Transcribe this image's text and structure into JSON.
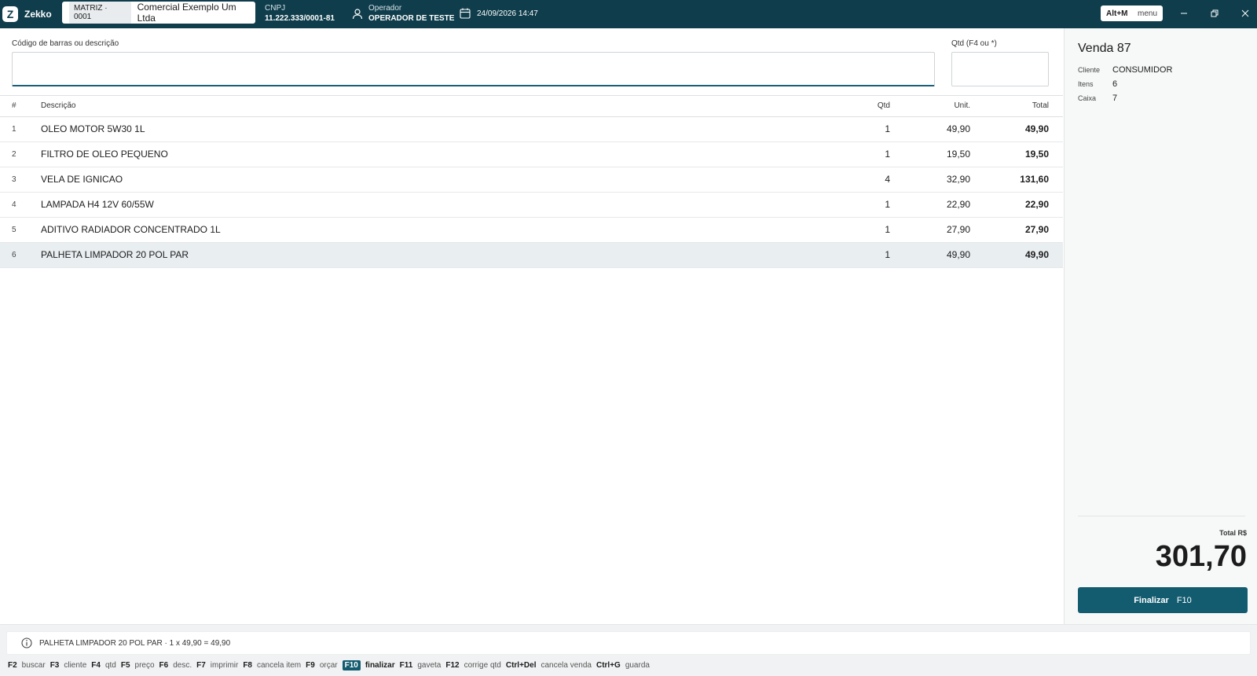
{
  "app": {
    "name": "Zekko",
    "logo_letter": "Z"
  },
  "header": {
    "company_code": "MATRIZ · 0001",
    "company_name": "Comercial Exemplo Um Ltda",
    "cnpj_label": "CNPJ",
    "cnpj_value": "11.222.333/0001-81",
    "operator_label": "Operador",
    "operator_value": "OPERADOR DE TESTE",
    "datetime": "24/09/2026 14:47",
    "menu_key": "Alt+M",
    "menu_label": "menu"
  },
  "search": {
    "barcode_label": "Código de barras ou descrição",
    "barcode_value": "",
    "qty_label": "Qtd (F4 ou *)",
    "qty_value": ""
  },
  "table": {
    "headers": {
      "num": "#",
      "desc": "Descrição",
      "qtd": "Qtd",
      "unit": "Unit.",
      "total": "Total"
    },
    "rows": [
      {
        "num": "1",
        "desc": "OLEO MOTOR 5W30 1L",
        "qtd": "1",
        "unit": "49,90",
        "total": "49,90"
      },
      {
        "num": "2",
        "desc": "FILTRO DE OLEO PEQUENO",
        "qtd": "1",
        "unit": "19,50",
        "total": "19,50"
      },
      {
        "num": "3",
        "desc": "VELA DE IGNICAO",
        "qtd": "4",
        "unit": "32,90",
        "total": "131,60"
      },
      {
        "num": "4",
        "desc": "LAMPADA H4 12V 60/55W",
        "qtd": "1",
        "unit": "22,90",
        "total": "22,90"
      },
      {
        "num": "5",
        "desc": "ADITIVO RADIADOR CONCENTRADO 1L",
        "qtd": "1",
        "unit": "27,90",
        "total": "27,90"
      },
      {
        "num": "6",
        "desc": "PALHETA LIMPADOR 20 POL PAR",
        "qtd": "1",
        "unit": "49,90",
        "total": "49,90"
      }
    ]
  },
  "sale": {
    "title": "Venda 87",
    "client_label": "Cliente",
    "client_value": "CONSUMIDOR",
    "items_label": "Itens",
    "items_value": "6",
    "register_label": "Caixa",
    "register_value": "7",
    "total_label": "Total R$",
    "total_value": "301,70",
    "finalize_label": "Finalizar",
    "finalize_key": "F10"
  },
  "status": {
    "message": "PALHETA LIMPADOR 20 POL PAR · 1 x 49,90 = 49,90"
  },
  "shortcuts": [
    {
      "key": "F2",
      "label": "buscar"
    },
    {
      "key": "F3",
      "label": "cliente"
    },
    {
      "key": "F4",
      "label": "qtd"
    },
    {
      "key": "F5",
      "label": "preço"
    },
    {
      "key": "F6",
      "label": "desc."
    },
    {
      "key": "F7",
      "label": "imprimir"
    },
    {
      "key": "F8",
      "label": "cancela item"
    },
    {
      "key": "F9",
      "label": "orçar"
    },
    {
      "key": "F10",
      "label": "finalizar"
    },
    {
      "key": "F11",
      "label": "gaveta"
    },
    {
      "key": "F12",
      "label": "corrige qtd"
    },
    {
      "key": "Ctrl+Del",
      "label": "cancela venda"
    },
    {
      "key": "Ctrl+G",
      "label": "guarda"
    }
  ],
  "colors": {
    "header_bg": "#0f3d4c",
    "accent": "#135c70",
    "selected_row": "#e9eef1"
  },
  "icons": [
    "zekko-logo-icon",
    "user-icon",
    "calendar-icon",
    "minimize-icon",
    "restore-icon",
    "close-icon",
    "info-icon"
  ]
}
